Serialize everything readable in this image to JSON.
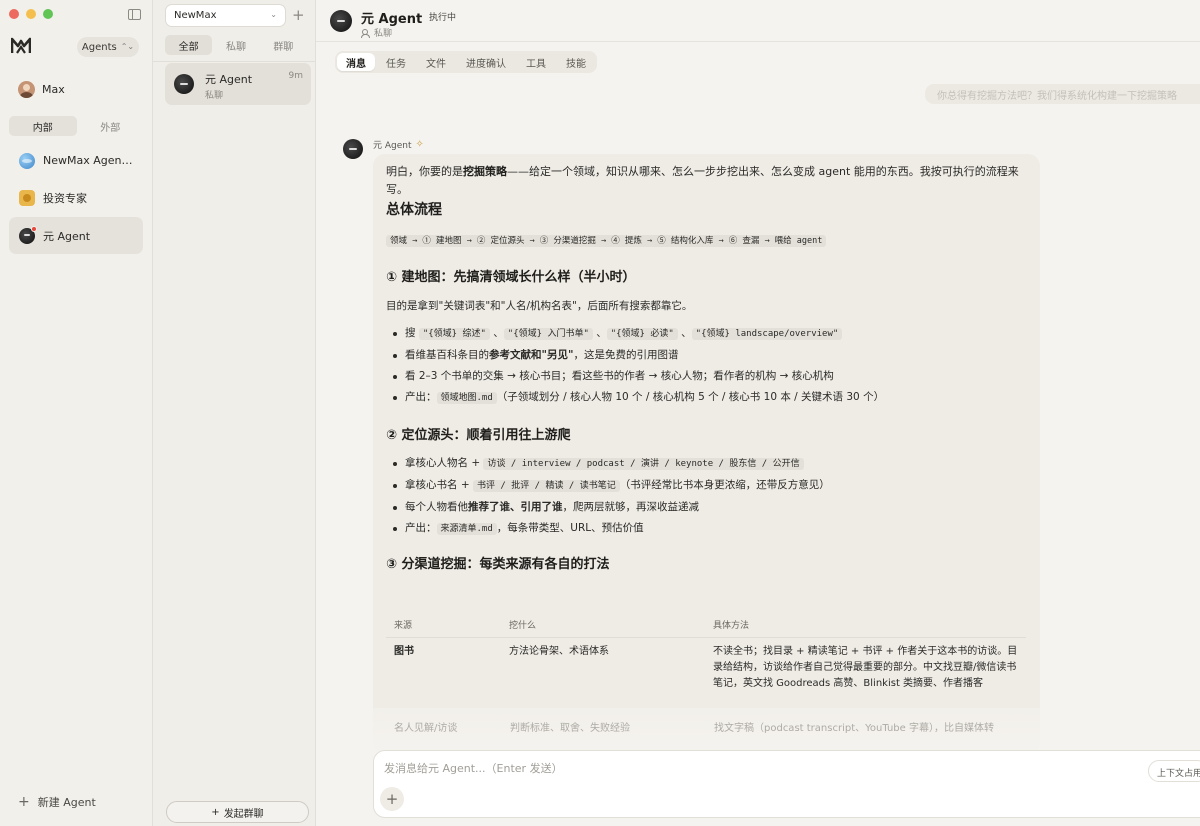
{
  "sidebar": {
    "agents_label": "Agents",
    "user_name": "Max",
    "seg_internal": "内部",
    "seg_external": "外部",
    "items": [
      {
        "label": "NewMax Agent ..."
      },
      {
        "label": "投资专家"
      },
      {
        "label": "元 Agent"
      }
    ],
    "new_agent": "新建 Agent"
  },
  "convlist": {
    "workspace": "NewMax",
    "tabs": [
      "全部",
      "私聊",
      "群聊"
    ],
    "items": [
      {
        "title": "元 Agent",
        "sub": "私聊",
        "time": "9m"
      }
    ],
    "group_button": "发起群聊"
  },
  "header": {
    "title": "元 Agent",
    "status": "执行中",
    "sub": "私聊"
  },
  "tabs": [
    "消息",
    "任务",
    "文件",
    "进度确认",
    "工具",
    "技能"
  ],
  "prev_message": "你总得有挖掘方法吧？我们得系统化构建一下挖掘策略",
  "message": {
    "sender": "元 Agent",
    "intro_a": "明白，你要的是",
    "intro_b": "挖掘策略",
    "intro_c": "——给定一个领域，知识从哪来、怎么一步步挖出来、怎么变成 agent 能用的东西。我按可执行的流程来写。",
    "h_overall": "总体流程",
    "flow": "领域 → ① 建地图 → ② 定位源头 → ③ 分渠道挖掘 → ④ 提炼 → ⑤ 结构化入库 → ⑥ 查漏 → 喂给 agent",
    "h1": "① 建地图：先搞清领域长什么样（半小时）",
    "h1_desc": "目的是拿到\"关键词表\"和\"人名/机构名表\"，后面所有搜索都靠它。",
    "s1": {
      "b1_pre": "搜 ",
      "b1_c1": "\"{领域} 综述\"",
      "b1_sep": " 、",
      "b1_c2": "\"{领域} 入门书单\"",
      "b1_c3": "\"{领域} 必读\"",
      "b1_c4": "\"{领域} landscape/overview\"",
      "b2_a": "看维基百科条目的",
      "b2_b": "参考文献和\"另见\"",
      "b2_c": "，这是免费的引用图谱",
      "b3": "看 2–3 个书单的交集 → 核心书目；看这些书的作者 → 核心人物；看作者的机构 → 核心机构",
      "b4_pre": "产出：",
      "b4_code": "领域地图.md",
      "b4_post": "（子领域划分 / 核心人物 10 个 / 核心机构 5 个 / 核心书 10 本 / 关键术语 30 个）"
    },
    "h2": "② 定位源头：顺着引用往上游爬",
    "s2": {
      "b1_pre": "拿核心人物名 + ",
      "b1_code": "访谈 / interview / podcast / 演讲 / keynote / 股东信 / 公开信",
      "b2_pre": "拿核心书名 + ",
      "b2_code": "书评 / 批评 / 精读 / 读书笔记",
      "b2_post": "（书评经常比书本身更浓缩，还带反方意见）",
      "b3_a": "每个人物看他",
      "b3_b": "推荐了谁、引用了谁",
      "b3_c": "，爬两层就够，再深收益递减",
      "b4_pre": "产出：",
      "b4_code": "来源清单.md",
      "b4_post": "，每条带类型、URL、预估价值"
    },
    "h3": "③ 分渠道挖掘：每类来源有各自的打法",
    "table": {
      "headers": [
        "来源",
        "挖什么",
        "具体方法"
      ],
      "rows": [
        {
          "c1": "图书",
          "c2": "方法论骨架、术语体系",
          "c3": "不读全书；找目录 + 精读笔记 + 书评 + 作者关于这本书的访谈。目录给结构，访谈给作者自己觉得最重要的部分。中文找豆瓣/微信读书笔记，英文找 Goodreads 高赞、Blinkist 类摘要、作者播客"
        },
        {
          "c1": "名人见解/访谈",
          "c2": "判断标准、取舍、失败经验",
          "c3": "找文字稿（podcast transcript、YouTube 字幕），比自媒体转"
        }
      ]
    }
  },
  "composer": {
    "placeholder": "发消息给元 Agent...（Enter 发送）",
    "context_label": "上下文占用"
  },
  "colors": {
    "traffic_red": "#ec6a5e",
    "traffic_yellow": "#f4bf4f",
    "traffic_green": "#61c554",
    "unread_dot": "#e5483c"
  }
}
